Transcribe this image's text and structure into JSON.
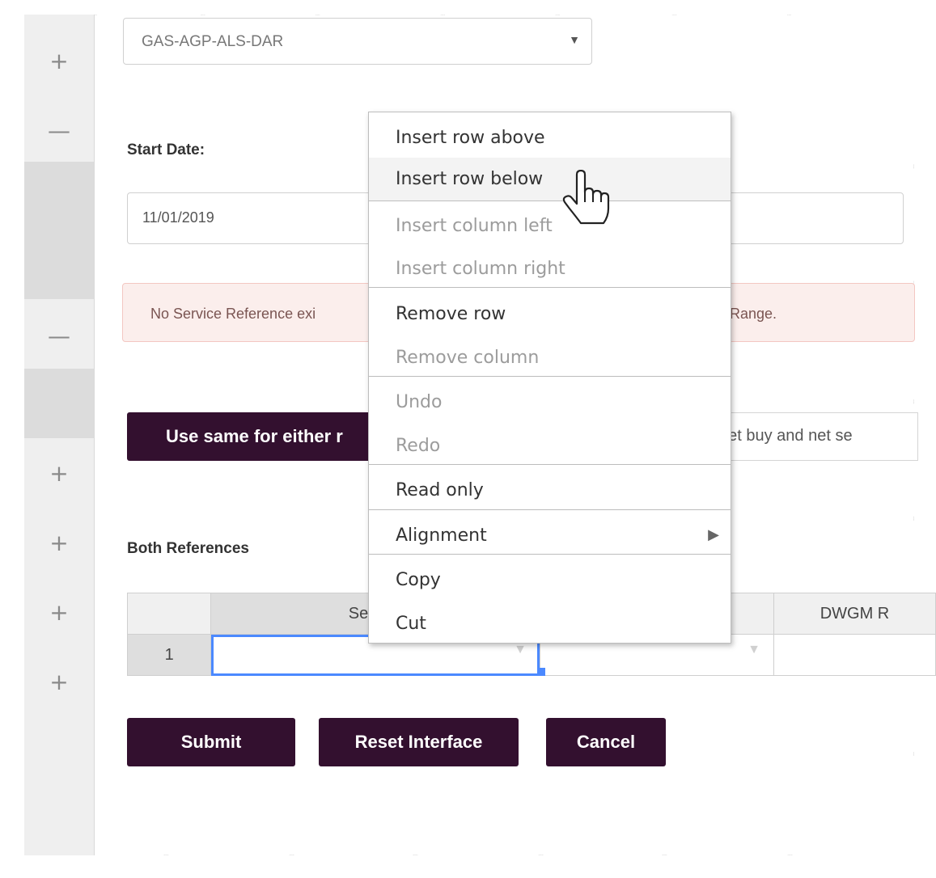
{
  "route_select": {
    "value": "GAS-AGP-ALS-DAR",
    "caret": "▼"
  },
  "gutter_buttons": [
    "+",
    "—",
    "—",
    "+",
    "+",
    "+",
    "+"
  ],
  "start_date": {
    "label": "Start Date:",
    "value": "11/01/2019"
  },
  "alert": {
    "text_left": "No Service Reference exi",
    "text_right": "Range."
  },
  "use_same_button": "Use same for either r",
  "net_buy_text": "net buy and net se",
  "section_title": "Both References",
  "grid": {
    "columns": [
      "",
      "Service",
      "",
      "DWGM R"
    ],
    "rows": [
      {
        "num": "1"
      }
    ],
    "dropdown_glyph": "▼"
  },
  "actions": {
    "submit": "Submit",
    "reset": "Reset Interface",
    "cancel": "Cancel"
  },
  "context_menu": {
    "insert_row_above": "Insert row above",
    "insert_row_below": "Insert row below",
    "insert_column_left": "Insert column left",
    "insert_column_right": "Insert column right",
    "remove_row": "Remove row",
    "remove_column": "Remove column",
    "undo": "Undo",
    "redo": "Redo",
    "read_only": "Read only",
    "alignment": "Alignment",
    "alignment_arrow": "▶",
    "copy": "Copy",
    "cut": "Cut"
  },
  "colors": {
    "accent": "#33102f",
    "selection": "#4b89ff",
    "alert_bg": "#fbeeec"
  },
  "icons": {
    "cursor": "hand-pointer-icon"
  }
}
